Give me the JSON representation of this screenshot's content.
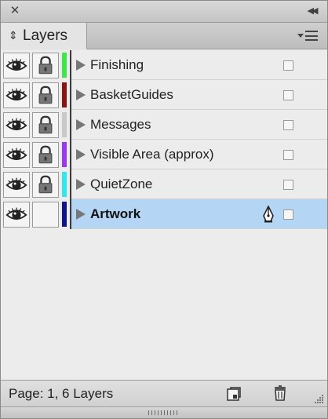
{
  "window": {
    "tab_label": "Layers",
    "tab_arrows": "⇕"
  },
  "layers": [
    {
      "name": "Finishing",
      "color": "#3ee84a",
      "visible": true,
      "locked": true,
      "selected": false
    },
    {
      "name": "BasketGuides",
      "color": "#8a1414",
      "visible": true,
      "locked": true,
      "selected": false
    },
    {
      "name": "Messages",
      "color": "#c9c9c9",
      "visible": true,
      "locked": true,
      "selected": false
    },
    {
      "name": "Visible Area (approx)",
      "color": "#9a38f0",
      "visible": true,
      "locked": true,
      "selected": false
    },
    {
      "name": "QuietZone",
      "color": "#2ee8ee",
      "visible": true,
      "locked": true,
      "selected": false
    },
    {
      "name": "Artwork",
      "color": "#10148a",
      "visible": true,
      "locked": false,
      "selected": true
    }
  ],
  "footer": {
    "status": "Page: 1, 6 Layers"
  },
  "icons": {
    "close": "close-icon",
    "collapse": "collapse-icon",
    "panel_menu": "panel-menu-icon",
    "eye": "eye-icon",
    "lock": "lock-icon",
    "expand": "disclosure-triangle-icon",
    "pen": "pen-nib-icon",
    "new_layer": "new-layer-icon",
    "delete": "trash-icon"
  },
  "colors": {
    "selection": "#b5d5f5"
  }
}
